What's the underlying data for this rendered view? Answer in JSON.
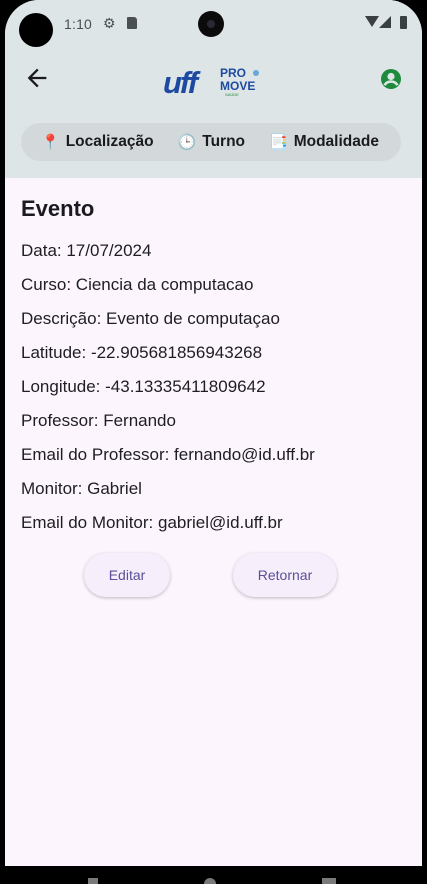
{
  "status_bar": {
    "time": "1:10"
  },
  "event": {
    "heading": "Evento",
    "fields": [
      "Data: 17/07/2024",
      "Curso: Ciencia da computacao",
      "Descrição: Evento de computaçao",
      "Latitude: -22.905681856943268",
      "Longitude: -43.13335411809642",
      "Professor: Fernando",
      "Email do Professor: fernando@id.uff.br",
      "Monitor: Gabriel",
      "Email do Monitor: gabriel@id.uff.br"
    ]
  },
  "filters": [
    {
      "icon": "📍",
      "label": "Localização"
    },
    {
      "icon": "🕒",
      "label": "Turno"
    },
    {
      "icon": "📑",
      "label": "Modalidade"
    }
  ],
  "actions": {
    "edit_label": "Editar",
    "back_label": "Retornar"
  },
  "logo": {
    "uff": "uff",
    "pro": "PRO",
    "move": "MOVE",
    "saude": "SAÚDE"
  },
  "colors": {
    "accent_green": "#1e8a3c",
    "logo_blue": "#1d4aa0",
    "button_text": "#5a4f98"
  }
}
